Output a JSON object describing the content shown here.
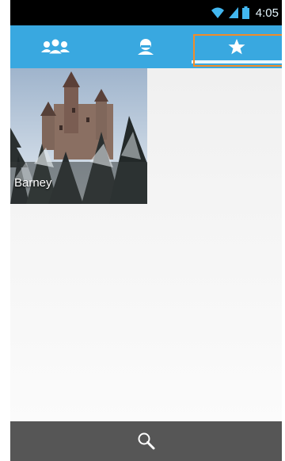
{
  "status_bar": {
    "time": "4:05",
    "icons": [
      "wifi-icon",
      "signal-icon",
      "battery-icon"
    ]
  },
  "tabs": [
    {
      "icon": "groups-icon",
      "selected": false
    },
    {
      "icon": "contact-icon",
      "selected": false
    },
    {
      "icon": "star-icon",
      "selected": true
    }
  ],
  "favorites": [
    {
      "name": "Barney",
      "image": "castle-in-snow-photo"
    }
  ],
  "bottom_bar": {
    "icon": "search-icon"
  },
  "colors": {
    "tab_bar": "#39a8e0",
    "selection_outline": "#f28c28",
    "bottom_bar": "#565656"
  }
}
